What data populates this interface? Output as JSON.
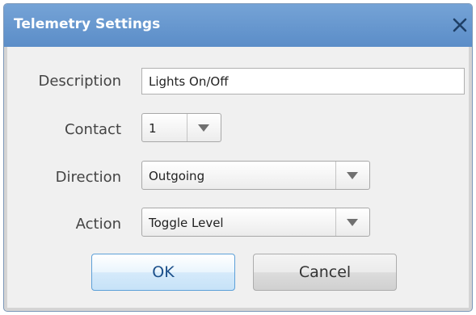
{
  "window": {
    "title": "Telemetry Settings",
    "title_bar_color": "#5b8dc8"
  },
  "form": {
    "description": {
      "label": "Description",
      "value": "Lights On/Off"
    },
    "contact": {
      "label": "Contact",
      "value": "1"
    },
    "direction": {
      "label": "Direction",
      "value": "Outgoing"
    },
    "action": {
      "label": "Action",
      "value": "Toggle Level"
    }
  },
  "buttons": {
    "ok_label": "OK",
    "cancel_label": "Cancel"
  },
  "icons": {
    "close": "close-icon",
    "dropdown": "chevron-down-icon"
  }
}
